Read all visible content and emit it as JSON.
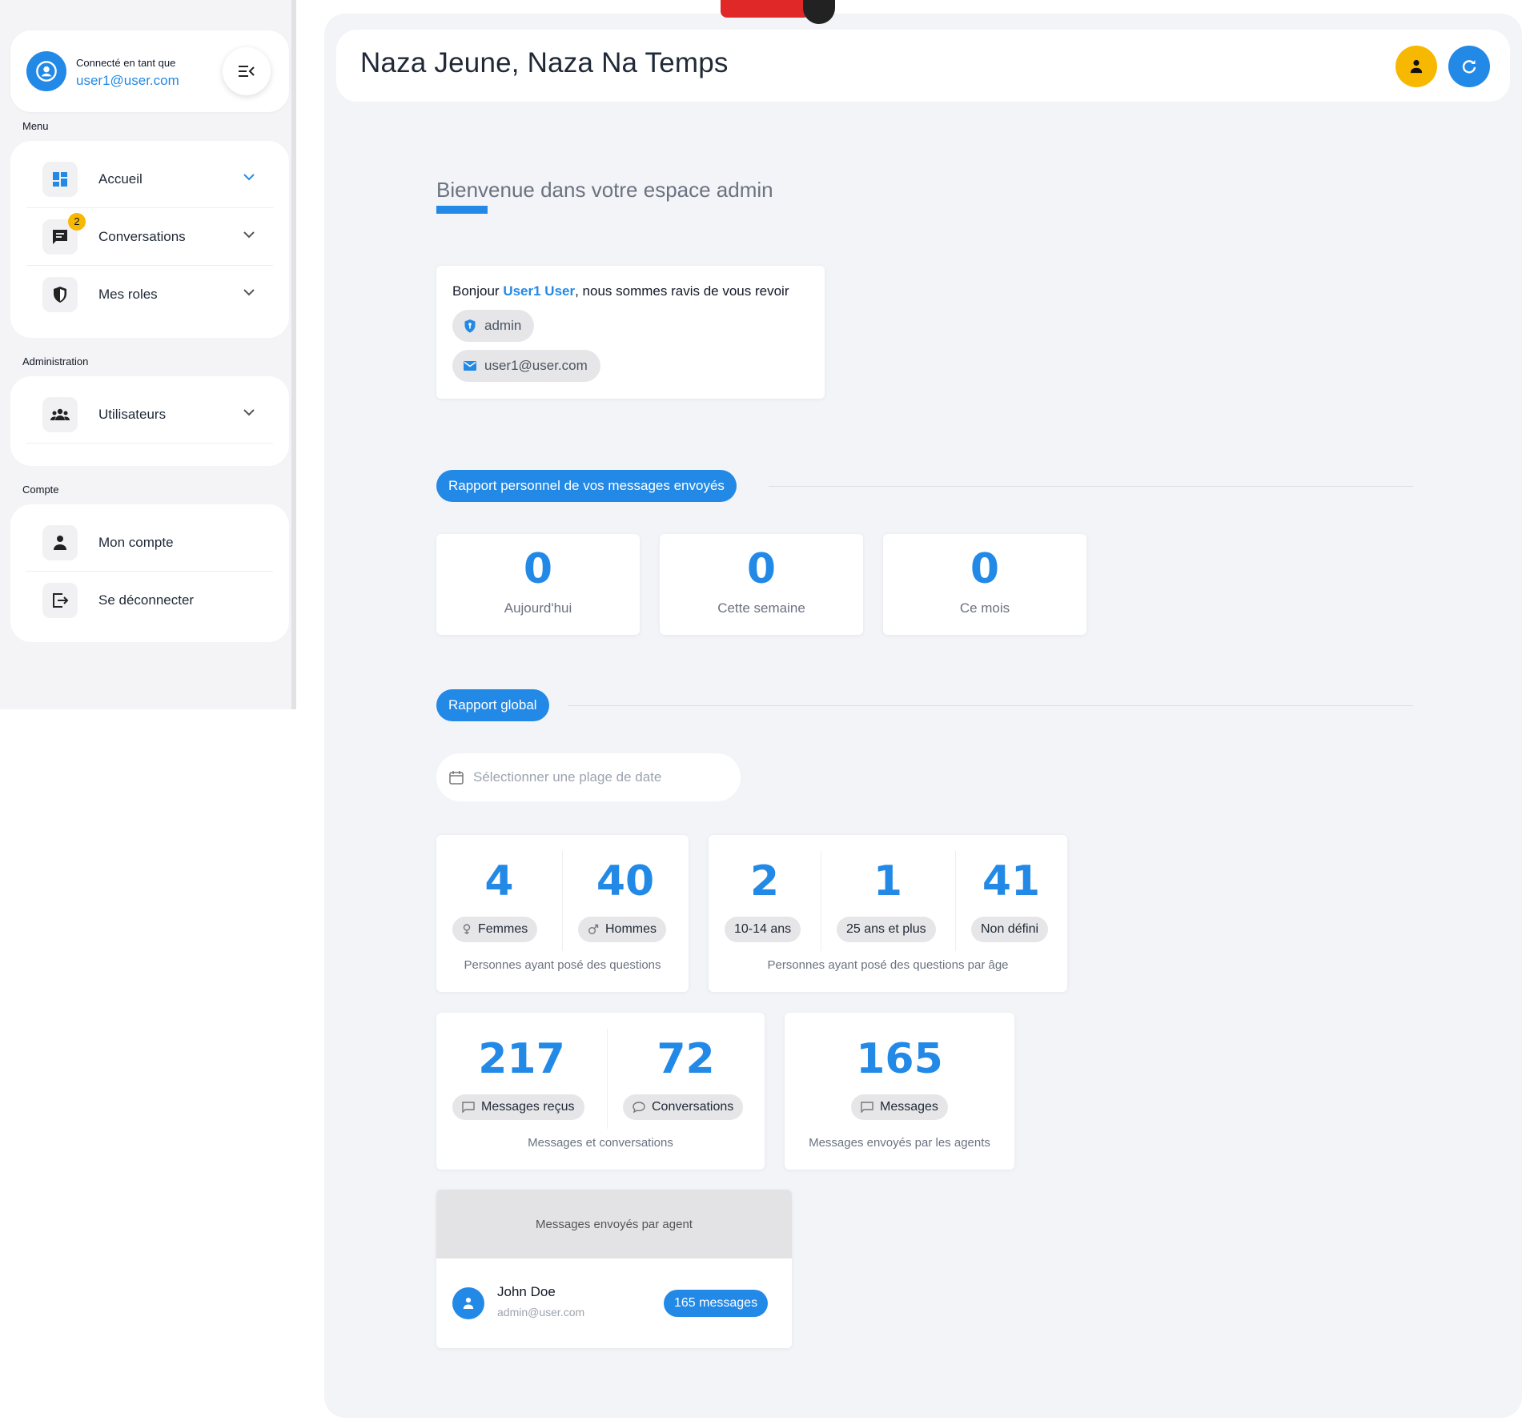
{
  "sidebar": {
    "user": {
      "label": "Connecté en tant que",
      "email": "user1@user.com"
    },
    "sections": {
      "menu": "Menu",
      "administration": "Administration",
      "account": "Compte"
    },
    "menu_items": [
      {
        "label": "Accueil",
        "icon": "dashboard-icon",
        "active": true
      },
      {
        "label": "Conversations",
        "icon": "chat-icon",
        "badge": "2"
      },
      {
        "label": "Mes roles",
        "icon": "shield-icon"
      }
    ],
    "admin_items": [
      {
        "label": "Utilisateurs",
        "icon": "users-icon"
      }
    ],
    "account_items": [
      {
        "label": "Mon compte",
        "icon": "person-icon"
      },
      {
        "label": "Se déconnecter",
        "icon": "logout-icon"
      }
    ]
  },
  "header": {
    "title": "Naza Jeune, Naza Na Temps"
  },
  "welcome": {
    "title": "Bienvenue dans votre espace admin"
  },
  "hello_card": {
    "prefix": "Bonjour ",
    "name": "User1 User",
    "suffix": ", nous sommes ravis de vous revoir",
    "role": "admin",
    "email": "user1@user.com"
  },
  "personal_report": {
    "label": "Rapport personnel de vos messages envoyés",
    "stats": [
      {
        "value": "0",
        "label": "Aujourd'hui"
      },
      {
        "value": "0",
        "label": "Cette semaine"
      },
      {
        "value": "0",
        "label": "Ce mois"
      }
    ]
  },
  "global_report": {
    "label": "Rapport global",
    "date_placeholder": "Sélectionner une plage de date",
    "gender": {
      "women": {
        "value": "4",
        "label": "Femmes"
      },
      "men": {
        "value": "40",
        "label": "Hommes"
      },
      "caption": "Personnes ayant posé des questions"
    },
    "age": {
      "groups": [
        {
          "value": "2",
          "label": "10-14 ans"
        },
        {
          "value": "1",
          "label": "25 ans et plus"
        },
        {
          "value": "41",
          "label": "Non défini"
        }
      ],
      "caption": "Personnes ayant posé des questions par âge"
    },
    "messages": {
      "received": {
        "value": "217",
        "label": "Messages reçus"
      },
      "conversations": {
        "value": "72",
        "label": "Conversations"
      },
      "caption": "Messages et conversations"
    },
    "agents_messages": {
      "value": "165",
      "label": "Messages",
      "caption": "Messages envoyés par les agents"
    },
    "per_agent": {
      "title": "Messages envoyés par agent",
      "agents": [
        {
          "name": "John Doe",
          "email": "admin@user.com",
          "count": "165 messages"
        }
      ]
    }
  },
  "colors": {
    "accent": "#2389e6",
    "warning": "#f7b801",
    "background": "#f3f4f8"
  }
}
